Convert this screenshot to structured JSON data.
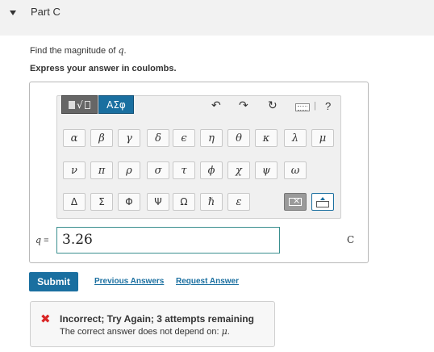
{
  "part": {
    "title": "Part C"
  },
  "question": {
    "prompt_prefix": "Find the magnitude of ",
    "prompt_var": "q",
    "prompt_suffix": ".",
    "instruction": "Express your answer in coulombs."
  },
  "toolbar": {
    "greek_tab": "ΑΣφ",
    "undo": "↶",
    "redo": "↷",
    "reset": "↻",
    "separator": "|",
    "help": "?"
  },
  "palette": {
    "row1": [
      "α",
      "β",
      "γ",
      "δ",
      "ϵ",
      "η",
      "θ",
      "κ",
      "λ",
      "μ"
    ],
    "row2": [
      "ν",
      "π",
      "ρ",
      "σ",
      "τ",
      "ϕ",
      "χ",
      "ψ",
      "ω"
    ],
    "row3": [
      "Δ",
      "Σ",
      "Φ",
      "Ψ",
      "Ω",
      "ℏ",
      "ε"
    ]
  },
  "answer": {
    "label_var": "q",
    "label_eq": " = ",
    "value": "3.26",
    "unit": "C"
  },
  "actions": {
    "submit": "Submit",
    "previous_answers": "Previous Answers",
    "request_answer": "Request Answer"
  },
  "feedback": {
    "icon": "✖",
    "title": "Incorrect; Try Again; 3 attempts remaining",
    "text_prefix": "The correct answer does not depend on: ",
    "text_var": "μ",
    "text_suffix": "."
  },
  "colors": {
    "accent": "#1a6fa0",
    "error": "#d92626",
    "input_border": "#3a8f8f"
  }
}
